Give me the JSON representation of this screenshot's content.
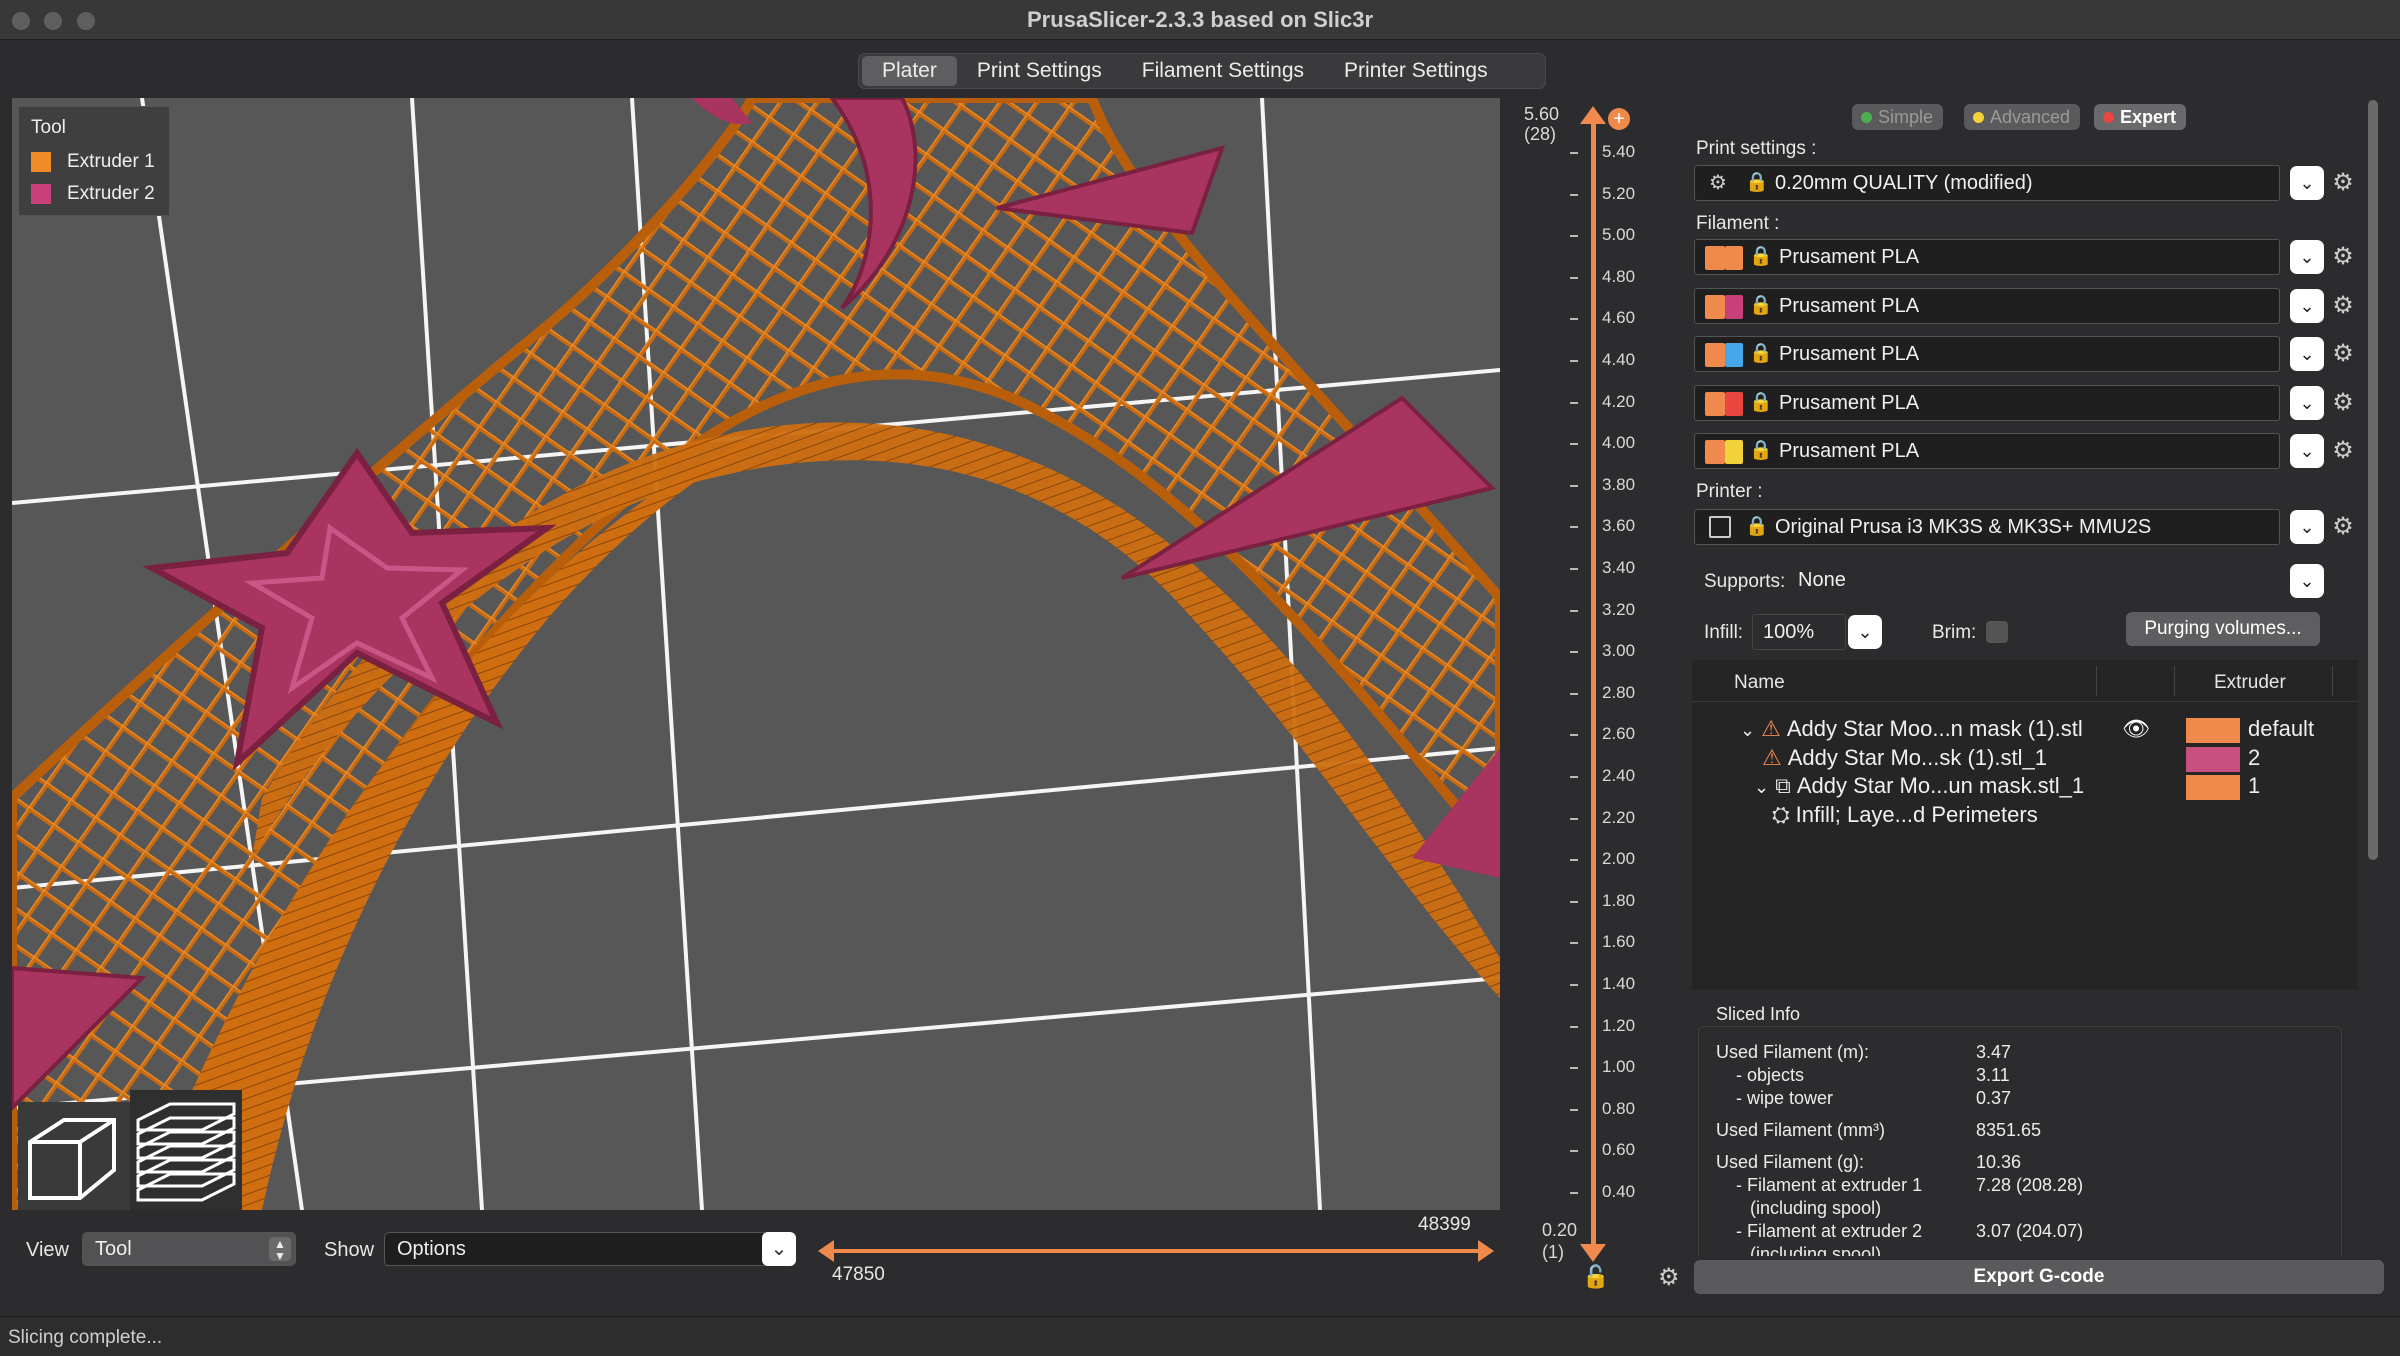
{
  "window": {
    "title": "PrusaSlicer-2.3.3 based on Slic3r"
  },
  "tabs": [
    "Plater",
    "Print Settings",
    "Filament Settings",
    "Printer Settings"
  ],
  "legend": {
    "title": "Tool",
    "items": [
      {
        "label": "Extruder 1",
        "color": "#f08a27"
      },
      {
        "label": "Extruder 2",
        "color": "#c8407a"
      }
    ]
  },
  "colors": {
    "extruder1": "#d9720f",
    "extruder2": "#a8345f",
    "accent": "#f08a4c",
    "bed": "#575757"
  },
  "ruler": {
    "top_value": "5.60",
    "top_layer": "(28)",
    "bottom_value": "0.20",
    "bottom_layer": "(1)",
    "ticks": [
      "5.40",
      "5.20",
      "5.00",
      "4.80",
      "4.60",
      "4.40",
      "4.20",
      "4.00",
      "3.80",
      "3.60",
      "3.40",
      "3.20",
      "3.00",
      "2.80",
      "2.60",
      "2.40",
      "2.20",
      "2.00",
      "1.80",
      "1.60",
      "1.40",
      "1.20",
      "1.00",
      "0.80",
      "0.60",
      "0.40"
    ]
  },
  "bottom": {
    "view_label": "View",
    "view_value": "Tool",
    "show_label": "Show",
    "show_value": "Options",
    "range_low": "47850",
    "range_high": "48399"
  },
  "modes": {
    "simple": "Simple",
    "advanced": "Advanced",
    "expert": "Expert"
  },
  "sidebar": {
    "print_settings_label": "Print settings :",
    "print_preset": "0.20mm QUALITY (modified)",
    "filament_label": "Filament :",
    "filaments": [
      {
        "name": "Prusament PLA",
        "color_a": "#f08a4c",
        "color_b": "#f08a4c"
      },
      {
        "name": "Prusament PLA",
        "color_a": "#f08a4c",
        "color_b": "#c8407a"
      },
      {
        "name": "Prusament PLA",
        "color_a": "#f08a4c",
        "color_b": "#46a7e8"
      },
      {
        "name": "Prusament PLA",
        "color_a": "#f08a4c",
        "color_b": "#e8463f"
      },
      {
        "name": "Prusament PLA",
        "color_a": "#f08a4c",
        "color_b": "#f2d13a"
      }
    ],
    "printer_label": "Printer :",
    "printer_preset": "Original Prusa i3 MK3S & MK3S+ MMU2S",
    "supports_label": "Supports:",
    "supports_value": "None",
    "infill_label": "Infill:",
    "infill_value": "100%",
    "brim_label": "Brim:",
    "purging_button": "Purging volumes..."
  },
  "object_list": {
    "col_name": "Name",
    "col_extruder": "Extruder",
    "rows": [
      {
        "label": "Addy Star Moo...n mask (1).stl",
        "extruder": "default",
        "ext_color": "#f08a4c"
      },
      {
        "label": "Addy Star Mo...sk (1).stl_1",
        "extruder": "2",
        "ext_color": "#c8507f"
      },
      {
        "label": "Addy Star Mo...un mask.stl_1",
        "extruder": "1",
        "ext_color": "#f08a4c"
      },
      {
        "label": "Infill; Laye...d Perimeters",
        "extruder": "",
        "ext_color": ""
      }
    ]
  },
  "sliced_info": {
    "title": "Sliced Info",
    "rows": [
      {
        "label": "Used Filament (m):",
        "value": "3.47"
      },
      {
        "label": "- objects",
        "value": "3.11"
      },
      {
        "label": "- wipe tower",
        "value": "0.37"
      },
      {
        "label": "Used Filament (mm³)",
        "value": "8351.65"
      },
      {
        "label": "Used Filament (g):",
        "value": "10.36"
      },
      {
        "label": "- Filament at extruder 1",
        "value": "7.28 (208.28)"
      },
      {
        "label": "(including spool)",
        "value": ""
      },
      {
        "label": "- Filament at extruder 2",
        "value": "3.07 (204.07)"
      },
      {
        "label": "(including spool)",
        "value": ""
      }
    ]
  },
  "export_button": "Export G-code",
  "status": "Slicing complete..."
}
